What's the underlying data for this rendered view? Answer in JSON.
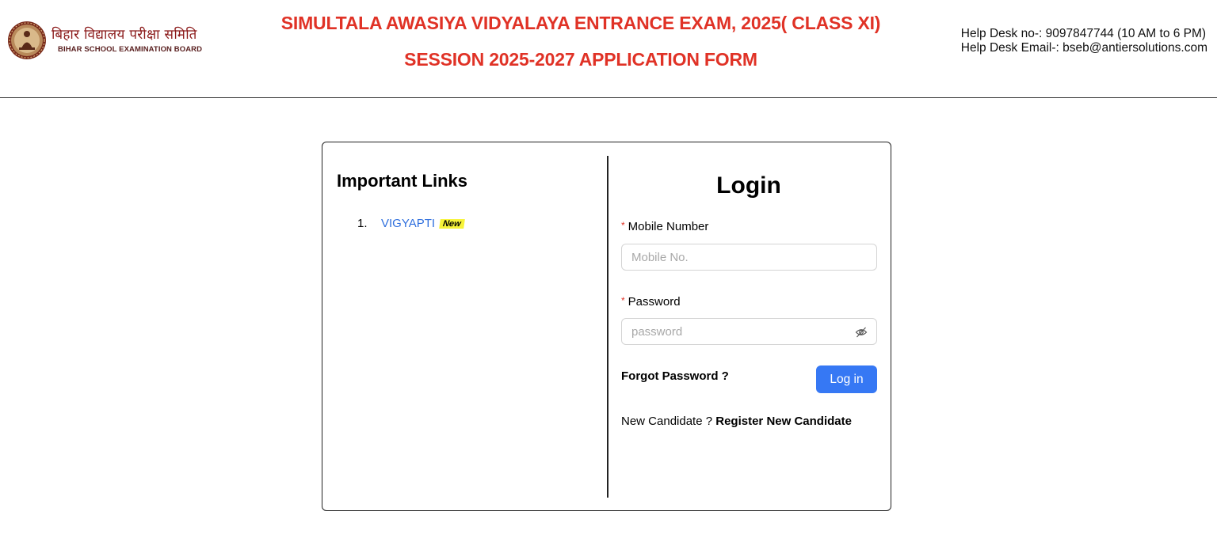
{
  "header": {
    "logo_hindi": "बिहार विद्यालय परीक्षा समिति",
    "logo_english": "BIHAR SCHOOL EXAMINATION BOARD",
    "title_line1": "SIMULTALA AWASIYA VIDYALAYA ENTRANCE EXAM, 2025( CLASS XI)",
    "title_line2": "SESSION 2025-2027 APPLICATION FORM",
    "helpdesk_phone": "Help Desk no-: 9097847744 (10 AM to 6 PM)",
    "helpdesk_email": "Help Desk Email-: bseb@antiersolutions.com"
  },
  "links": {
    "title": "Important Links",
    "items": [
      {
        "number": "1.",
        "label": "VIGYAPTI",
        "badge": "New"
      }
    ]
  },
  "login": {
    "title": "Login",
    "mobile_label": "Mobile Number",
    "mobile_placeholder": "Mobile No.",
    "password_label": "Password",
    "password_placeholder": "password",
    "required_mark": "*",
    "forgot_label": "Forgot Password ?",
    "login_button": "Log in",
    "new_candidate_text": "New Candidate ?",
    "register_label": "Register New Candidate"
  },
  "colors": {
    "title_red": "#e03226",
    "link_blue": "#2f6fde",
    "button_blue": "#3678f4",
    "badge_yellow": "#f7f339"
  },
  "icons": {
    "logo": "bseb-emblem-icon",
    "password_toggle": "eye-slash-icon"
  }
}
